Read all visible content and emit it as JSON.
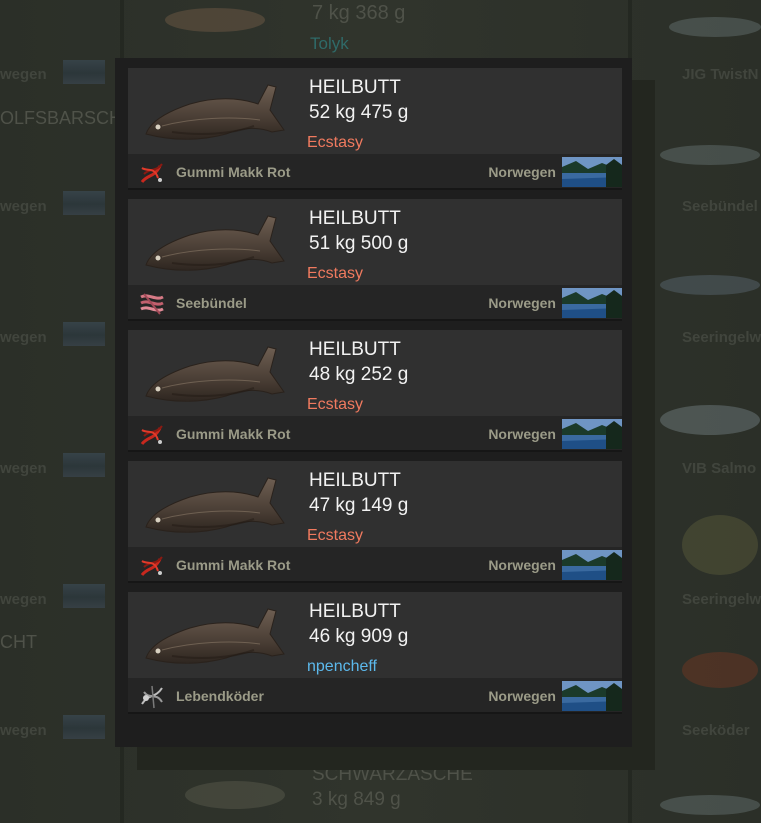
{
  "background": {
    "top_weight": "7 kg 368 g",
    "top_angler": "Tolyk",
    "left_names": [
      "OLFSBARSCH",
      "CHT"
    ],
    "left_locations": [
      "wegen",
      "wegen",
      "wegen",
      "wegen",
      "wegen",
      "wegen"
    ],
    "right_baits": [
      "JIG TwistN",
      "Seebündel",
      "Seeringelw",
      "VIB Salmo",
      "Seeringelw",
      "Seeköder"
    ],
    "bottom_name": "SCHWARZÄSCHE",
    "bottom_weight": "3 kg 849 g"
  },
  "colors": {
    "angler_ecstasy": "#f07a5f",
    "angler_npencheff": "#5cb9ec"
  },
  "entries": [
    {
      "fish": "HEILBUTT",
      "weight": "52 kg 475 g",
      "angler": "Ecstasy",
      "angler_color": "#f07a5f",
      "bait": "Gummi Makk Rot",
      "bait_icon": "red-jig-icon",
      "location": "Norwegen",
      "location_icon": "norway-fjord-thumbnail"
    },
    {
      "fish": "HEILBUTT",
      "weight": "51 kg 500 g",
      "angler": "Ecstasy",
      "angler_color": "#f07a5f",
      "bait": "Seebündel",
      "bait_icon": "worm-bundle-icon",
      "location": "Norwegen",
      "location_icon": "norway-fjord-thumbnail"
    },
    {
      "fish": "HEILBUTT",
      "weight": "48 kg 252 g",
      "angler": "Ecstasy",
      "angler_color": "#f07a5f",
      "bait": "Gummi Makk Rot",
      "bait_icon": "red-jig-icon",
      "location": "Norwegen",
      "location_icon": "norway-fjord-thumbnail"
    },
    {
      "fish": "HEILBUTT",
      "weight": "47 kg 149 g",
      "angler": "Ecstasy",
      "angler_color": "#f07a5f",
      "bait": "Gummi Makk Rot",
      "bait_icon": "red-jig-icon",
      "location": "Norwegen",
      "location_icon": "norway-fjord-thumbnail"
    },
    {
      "fish": "HEILBUTT",
      "weight": "46 kg 909 g",
      "angler": "npencheff",
      "angler_color": "#5cb9ec",
      "bait": "Lebendköder",
      "bait_icon": "live-bait-icon",
      "location": "Norwegen",
      "location_icon": "norway-fjord-thumbnail"
    }
  ]
}
